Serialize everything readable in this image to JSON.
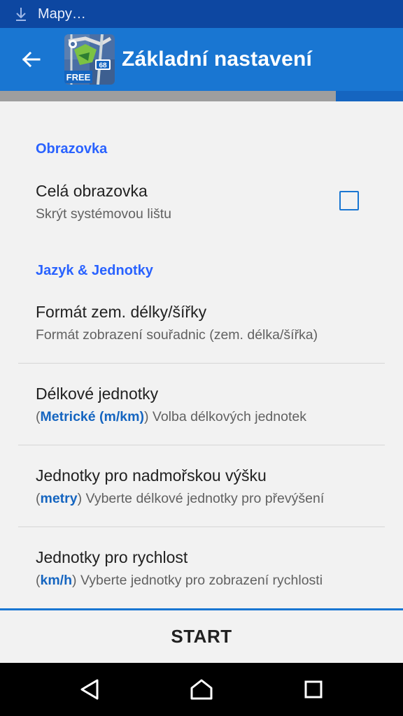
{
  "status_bar": {
    "text": "Mapy…",
    "icon": "download-icon"
  },
  "toolbar": {
    "title": "Základní nastavení",
    "back_icon": "arrow-back-icon",
    "app_icon_badge": "FREE",
    "app_icon_number": "68",
    "color": "#1976d2"
  },
  "progress": {
    "value": 0.833
  },
  "sections": [
    {
      "header": "Obrazovka",
      "items": [
        {
          "title": "Celá obrazovka",
          "summary": "Skrýt systémovou lištu",
          "checkbox_checked": false
        }
      ]
    },
    {
      "header": "Jazyk & Jednotky",
      "items": [
        {
          "title": "Formát zem. délky/šířky",
          "summary": "Formát zobrazení souřadnic (zem. délka/šířka)"
        },
        {
          "title": "Délkové jednotky",
          "value": "Metrické (m/km)",
          "summary": "Volba délkových jednotek"
        },
        {
          "title": "Jednotky pro nadmořskou výšku",
          "value": "metry",
          "summary": "Vyberte délkové jednotky pro převýšení"
        },
        {
          "title": "Jednotky pro rychlost",
          "value": "km/h",
          "summary": "Vyberte jednotky pro zobrazení rychlosti"
        }
      ]
    }
  ],
  "start_button": {
    "label": "START"
  },
  "nav": {
    "back_icon": "nav-back-icon",
    "home_icon": "nav-home-icon",
    "recents_icon": "nav-recents-icon"
  },
  "colors": {
    "accent": "#2962ff",
    "status_bar": "#0d47a1",
    "value_text": "#1565c0"
  }
}
